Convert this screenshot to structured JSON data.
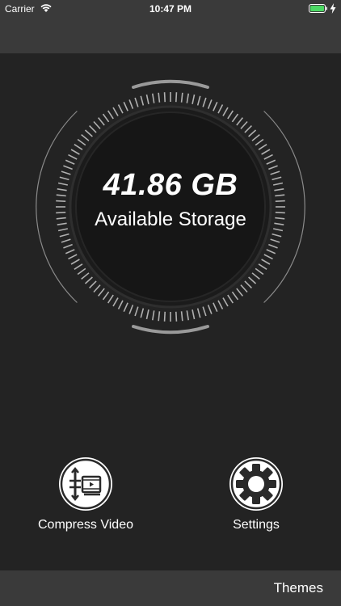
{
  "status_bar": {
    "carrier": "Carrier",
    "time": "10:47 PM",
    "battery_color": "#4cd964"
  },
  "storage": {
    "value": "41.86 GB",
    "label": "Available Storage"
  },
  "actions": {
    "compress_video": {
      "label": "Compress Video",
      "icon": "compress-video-icon"
    },
    "settings": {
      "label": "Settings",
      "icon": "gear-icon"
    }
  },
  "tab_bar": {
    "themes_label": "Themes"
  },
  "colors": {
    "background": "#232323",
    "bars": "#3a3a3a",
    "text": "#ffffff"
  }
}
